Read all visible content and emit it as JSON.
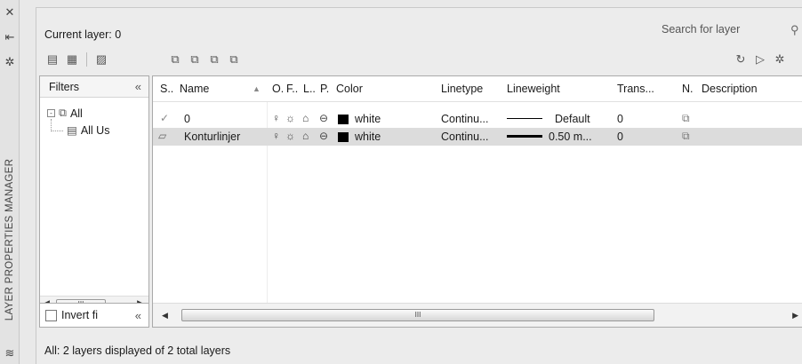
{
  "strip": {
    "title": "LAYER PROPERTIES MANAGER"
  },
  "header": {
    "current_layer": "Current layer: 0",
    "search_placeholder": "Search for layer"
  },
  "filters": {
    "header": "Filters",
    "collapse_glyph": "«",
    "tree": [
      {
        "label": "All",
        "expand": "-"
      },
      {
        "label": "All Us"
      }
    ],
    "scroll_thumb": "III",
    "invert_label": "Invert fi"
  },
  "grid": {
    "columns": [
      "S..",
      "Name",
      "O.",
      "F..",
      "L..",
      "P.",
      "Color",
      "Linetype",
      "Lineweight",
      "Trans...",
      "N.",
      "Description"
    ],
    "rows": [
      {
        "name": "0",
        "color_name": "white",
        "color": "#000000",
        "linetype": "Continu...",
        "lineweight": "Default",
        "transparency": "0",
        "selected": false
      },
      {
        "name": "Konturlinjer",
        "color_name": "white",
        "color": "#000000",
        "linetype": "Continu...",
        "lineweight": "0.50 m...",
        "transparency": "0",
        "selected": true
      }
    ],
    "scroll_thumb": "III"
  },
  "status": "All: 2 layers displayed of 2 total layers",
  "icons": [
    "close-icon",
    "pin-icon",
    "settings-icon",
    "new-property-filter-icon",
    "new-group-filter-icon",
    "layer-states-icon",
    "new-layer-icon",
    "new-layer-frozen-icon",
    "delete-layer-icon",
    "set-current-icon",
    "refresh-icon",
    "settings-icon",
    "lightbulb-icon",
    "sun-icon",
    "unlock-icon",
    "plot-icon",
    "current-check-icon",
    "layer-icon",
    "new-vp-freeze-icon",
    "layers-icon"
  ]
}
